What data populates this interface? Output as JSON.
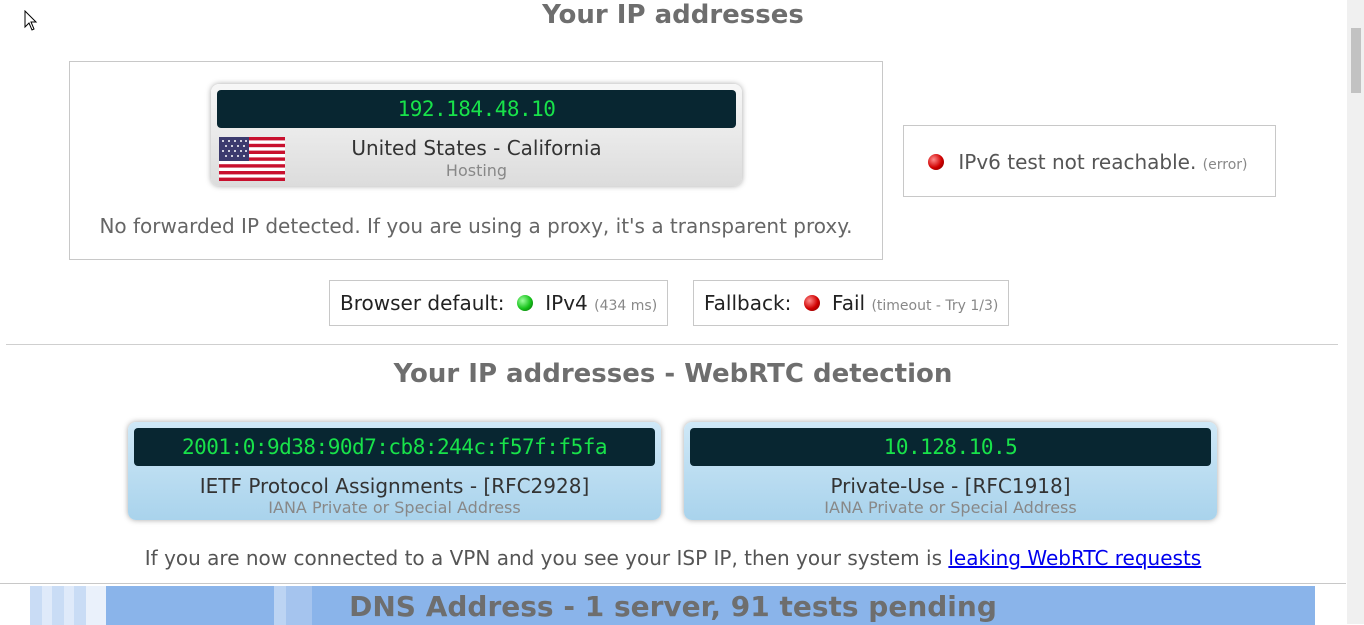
{
  "section1": {
    "title": "Your IP addresses",
    "ipv4": {
      "ip": "192.184.48.10",
      "location": "United States - California",
      "type": "Hosting"
    },
    "forwarded_note": "No forwarded IP detected. If you are using a proxy, it's a transparent proxy.",
    "ipv6": {
      "text": "IPv6 test not reachable.",
      "status": "(error)",
      "status_color": "#d00000"
    },
    "browser_default": {
      "label": "Browser default:",
      "value": "IPv4",
      "detail": "(434 ms)",
      "status_color": "#16c21a"
    },
    "fallback": {
      "label": "Fallback:",
      "value": "Fail",
      "detail": "(timeout - Try 1/3)",
      "status_color": "#d00000"
    }
  },
  "webrtc": {
    "title": "Your IP addresses - WebRTC detection",
    "cards": [
      {
        "ip": "2001:0:9d38:90d7:cb8:244c:f57f:f5fa",
        "name": "IETF Protocol Assignments - [RFC2928]",
        "sub": "IANA Private or Special Address"
      },
      {
        "ip": "10.128.10.5",
        "name": "Private-Use - [RFC1918]",
        "sub": "IANA Private or Special Address"
      }
    ],
    "leak_text": "If you are now connected to a VPN and you see your ISP IP, then your system is",
    "leak_link": "leaking WebRTC requests"
  },
  "dns": {
    "title": "DNS Address - 1 server, 91 tests pending"
  },
  "icons": {
    "flag": "us-flag-icon",
    "cursor": "mouse-cursor-icon"
  },
  "colors": {
    "ip_text": "#18e24a",
    "ip_bg": "#082631",
    "dns_bar": "#8ab4ea"
  }
}
